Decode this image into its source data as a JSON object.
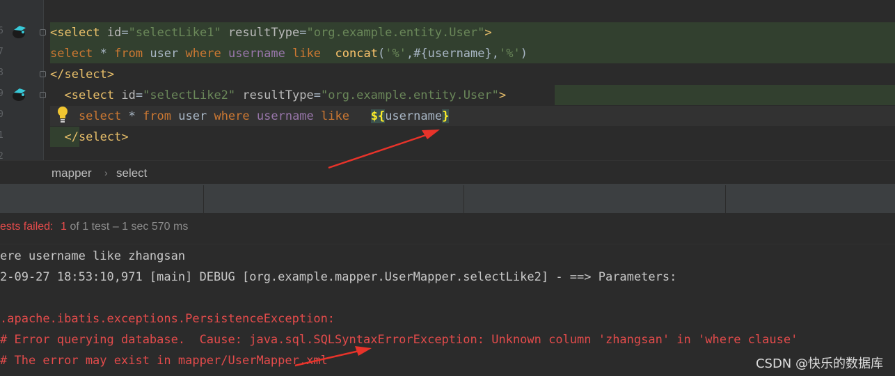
{
  "editor": {
    "line_numbers": [
      "6",
      "7",
      "8",
      "9",
      "0",
      "1",
      "2"
    ],
    "lines": [
      {
        "parts": [
          {
            "t": "<select ",
            "c": "tag"
          },
          {
            "t": "id",
            "c": "attr"
          },
          {
            "t": "=",
            "c": "plain"
          },
          {
            "t": "\"selectLike1\"",
            "c": "str"
          },
          {
            "t": " resultType",
            "c": "attr"
          },
          {
            "t": "=",
            "c": "plain"
          },
          {
            "t": "\"org.example.entity.User\"",
            "c": "str"
          },
          {
            "t": ">",
            "c": "tag"
          }
        ]
      },
      {
        "parts": [
          {
            "t": "select",
            "c": "kw"
          },
          {
            "t": " * ",
            "c": "plain"
          },
          {
            "t": "from",
            "c": "kw"
          },
          {
            "t": " user ",
            "c": "plain"
          },
          {
            "t": "where",
            "c": "kw"
          },
          {
            "t": " ",
            "c": "plain"
          },
          {
            "t": "username",
            "c": "id"
          },
          {
            "t": " ",
            "c": "plain"
          },
          {
            "t": "like",
            "c": "kw"
          },
          {
            "t": "  ",
            "c": "plain"
          },
          {
            "t": "concat",
            "c": "fn"
          },
          {
            "t": "(",
            "c": "plain"
          },
          {
            "t": "'%'",
            "c": "str"
          },
          {
            "t": ",#{username},",
            "c": "plain"
          },
          {
            "t": "'%'",
            "c": "str"
          },
          {
            "t": ")",
            "c": "plain"
          }
        ]
      },
      {
        "parts": [
          {
            "t": "</select>",
            "c": "tag"
          }
        ]
      },
      {
        "parts": [
          {
            "t": "  <select ",
            "c": "tag"
          },
          {
            "t": "id",
            "c": "attr"
          },
          {
            "t": "=",
            "c": "plain"
          },
          {
            "t": "\"selectLike2\"",
            "c": "str"
          },
          {
            "t": " resultType",
            "c": "attr"
          },
          {
            "t": "=",
            "c": "plain"
          },
          {
            "t": "\"org.example.entity.User\"",
            "c": "str"
          },
          {
            "t": ">",
            "c": "tag"
          }
        ]
      },
      {
        "parts": [
          {
            "t": "    select",
            "c": "kw"
          },
          {
            "t": " * ",
            "c": "plain"
          },
          {
            "t": "from",
            "c": "kw"
          },
          {
            "t": " user ",
            "c": "plain"
          },
          {
            "t": "where",
            "c": "kw"
          },
          {
            "t": " ",
            "c": "plain"
          },
          {
            "t": "username",
            "c": "id"
          },
          {
            "t": " ",
            "c": "plain"
          },
          {
            "t": "like",
            "c": "kw"
          },
          {
            "t": "   ",
            "c": "plain"
          },
          {
            "t": "${",
            "c": "dollar"
          },
          {
            "t": "username",
            "c": "plain"
          },
          {
            "t": "}",
            "c": "dollar"
          }
        ]
      },
      {
        "parts": [
          {
            "t": "  </select>",
            "c": "tag"
          }
        ]
      }
    ]
  },
  "breadcrumb": {
    "item1": "mapper",
    "separator": "›",
    "item2": "select"
  },
  "status": {
    "failed_label": "ests failed: ",
    "failed_count": "1",
    "rest": " of 1 test – 1 sec 570 ms"
  },
  "console": {
    "lines": [
      {
        "text": "ere username like zhangsan",
        "color": "#c8c8c8"
      },
      {
        "text": "2-09-27 18:53:10,971 [main] DEBUG [org.example.mapper.UserMapper.selectLike2] - ==> Parameters:",
        "color": "#c8c8c8"
      },
      {
        "text": "",
        "color": "#c8c8c8"
      },
      {
        "text": ".apache.ibatis.exceptions.PersistenceException:",
        "color": "#e34b4b"
      },
      {
        "text": "# Error querying database.  Cause: java.sql.SQLSyntaxErrorException: Unknown column 'zhangsan' in 'where clause'",
        "color": "#e34b4b"
      },
      {
        "text": "# The error may exist in mapper/UserMapper.xml",
        "color": "#e34b4b"
      }
    ]
  },
  "watermark": "CSDN @快乐的数据库",
  "colors": {
    "error": "#e34b4b",
    "annotation_arrow": "#e8332a",
    "editor_bg": "#2b2b2b"
  },
  "icons": [
    "mybatis-bird-icon",
    "lightbulb-icon",
    "fold-marker-icon",
    "breadcrumb-chevron-icon"
  ]
}
